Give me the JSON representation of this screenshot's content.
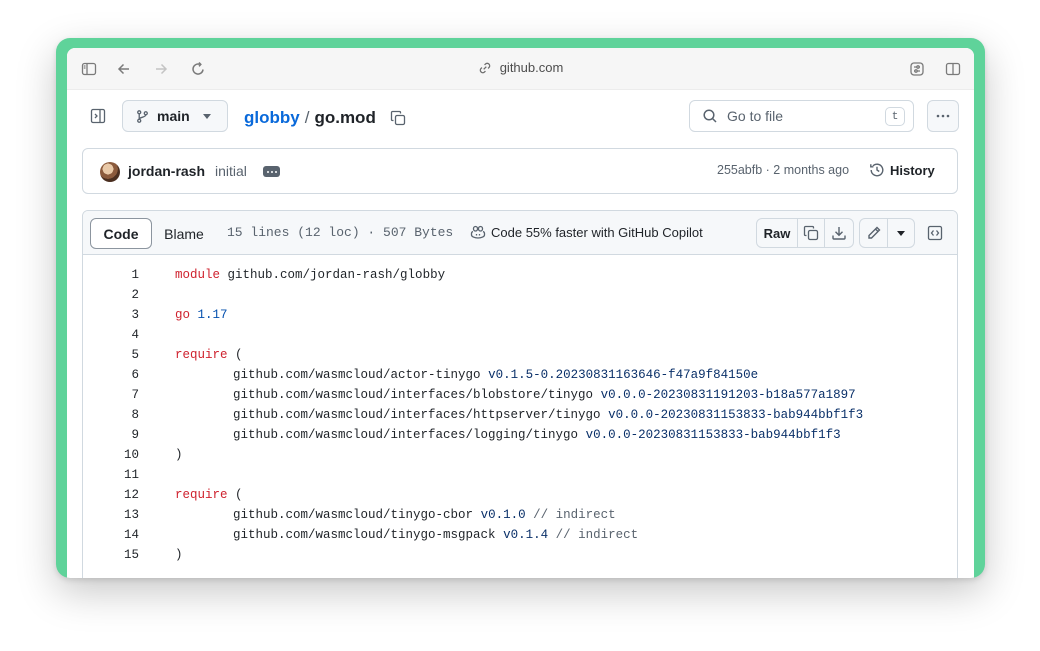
{
  "browser": {
    "url": "github.com"
  },
  "filebar": {
    "branch": "main",
    "repo": "globby",
    "separator": "/",
    "filename": "go.mod",
    "goto_placeholder": "Go to file",
    "goto_shortcut": "t"
  },
  "commit": {
    "author": "jordan-rash",
    "message": "initial",
    "meta": "255abfb · 2 months ago",
    "history_label": "History"
  },
  "file_header": {
    "tab_code": "Code",
    "tab_blame": "Blame",
    "stats": "15 lines (12 loc) · 507 Bytes",
    "copilot": "Code 55% faster with GitHub Copilot",
    "raw_label": "Raw"
  },
  "code": {
    "lines": [
      {
        "n": "1",
        "indent": false,
        "kw": "module",
        "path": "github.com/jordan-rash/globby",
        "ver": "",
        "cm": "",
        "plain": ""
      },
      {
        "n": "2",
        "indent": false,
        "kw": "",
        "path": "",
        "ver": "",
        "cm": "",
        "plain": ""
      },
      {
        "n": "3",
        "indent": false,
        "kw": "go",
        "path": "",
        "ver": "1.17",
        "cm": "",
        "plain": ""
      },
      {
        "n": "4",
        "indent": false,
        "kw": "",
        "path": "",
        "ver": "",
        "cm": "",
        "plain": ""
      },
      {
        "n": "5",
        "indent": false,
        "kw": "require",
        "path": "",
        "ver": "",
        "cm": "",
        "plain": "("
      },
      {
        "n": "6",
        "indent": true,
        "kw": "",
        "path": "github.com/wasmcloud/actor-tinygo",
        "ver": "v0.1.5-0.20230831163646-f47a9f84150e",
        "cm": "",
        "plain": ""
      },
      {
        "n": "7",
        "indent": true,
        "kw": "",
        "path": "github.com/wasmcloud/interfaces/blobstore/tinygo",
        "ver": "v0.0.0-20230831191203-b18a577a1897",
        "cm": "",
        "plain": ""
      },
      {
        "n": "8",
        "indent": true,
        "kw": "",
        "path": "github.com/wasmcloud/interfaces/httpserver/tinygo",
        "ver": "v0.0.0-20230831153833-bab944bbf1f3",
        "cm": "",
        "plain": ""
      },
      {
        "n": "9",
        "indent": true,
        "kw": "",
        "path": "github.com/wasmcloud/interfaces/logging/tinygo",
        "ver": "v0.0.0-20230831153833-bab944bbf1f3",
        "cm": "",
        "plain": ""
      },
      {
        "n": "10",
        "indent": false,
        "kw": "",
        "path": "",
        "ver": "",
        "cm": "",
        "plain": ")"
      },
      {
        "n": "11",
        "indent": false,
        "kw": "",
        "path": "",
        "ver": "",
        "cm": "",
        "plain": ""
      },
      {
        "n": "12",
        "indent": false,
        "kw": "require",
        "path": "",
        "ver": "",
        "cm": "",
        "plain": "("
      },
      {
        "n": "13",
        "indent": true,
        "kw": "",
        "path": "github.com/wasmcloud/tinygo-cbor",
        "ver": "v0.1.0",
        "cm": "// indirect",
        "plain": ""
      },
      {
        "n": "14",
        "indent": true,
        "kw": "",
        "path": "github.com/wasmcloud/tinygo-msgpack",
        "ver": "v0.1.4",
        "cm": "// indirect",
        "plain": ""
      },
      {
        "n": "15",
        "indent": false,
        "kw": "",
        "path": "",
        "ver": "",
        "cm": "",
        "plain": ")"
      }
    ]
  }
}
